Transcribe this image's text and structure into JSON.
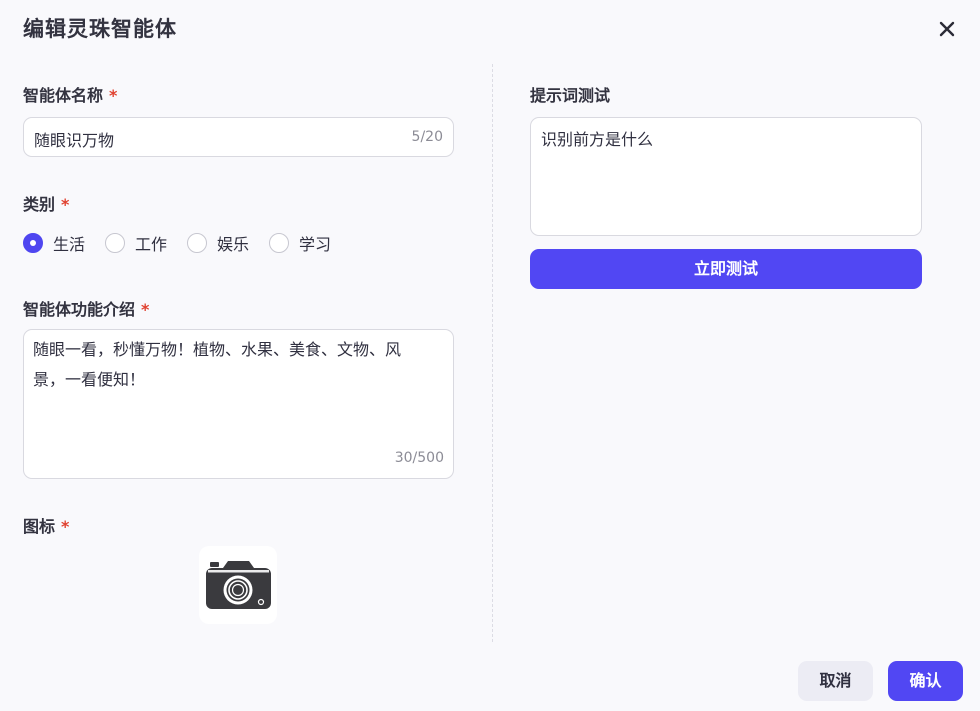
{
  "dialog": {
    "title": "编辑灵珠智能体",
    "close_icon": "close-icon"
  },
  "name_field": {
    "label": "智能体名称",
    "required_mark": "*",
    "value": "随眼识万物",
    "counter": "5/20"
  },
  "category": {
    "label": "类别",
    "required_mark": "*",
    "options": [
      {
        "label": "生活",
        "checked": true
      },
      {
        "label": "工作",
        "checked": false
      },
      {
        "label": "娱乐",
        "checked": false
      },
      {
        "label": "学习",
        "checked": false
      }
    ]
  },
  "description": {
    "label": "智能体功能介绍",
    "required_mark": "*",
    "line1": "随眼一看，秒懂万物！植物、水果、美食、文物、风",
    "line2": "景，一看便知！",
    "counter": "30/500"
  },
  "icon_field": {
    "label": "图标",
    "required_mark": "*",
    "icon": "camera-icon"
  },
  "prompt_test": {
    "label": "提示词测试",
    "value": "识别前方是什么",
    "button_label": "立即测试"
  },
  "footer": {
    "cancel_label": "取消",
    "confirm_label": "确认"
  },
  "colors": {
    "accent": "#5147f3",
    "required": "#e0412f",
    "background": "#f9f9fc"
  }
}
